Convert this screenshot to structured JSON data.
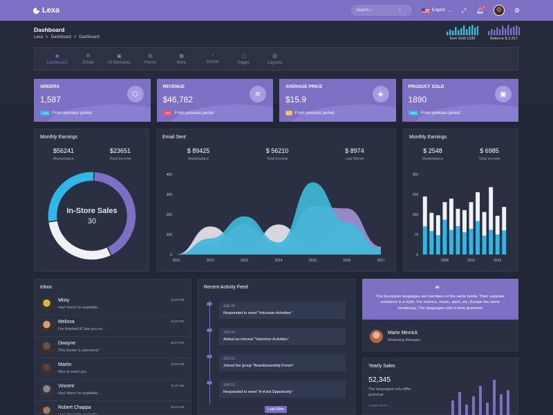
{
  "topbar": {
    "logo": "Lexa",
    "search_placeholder": "Search...",
    "language": "English",
    "notification_count": "3"
  },
  "header": {
    "title": "Dashboard",
    "breadcrumb": [
      "Lexa",
      ">",
      "Dashboard",
      ">",
      "Dashboard"
    ],
    "mini_stats": [
      {
        "label": "Item Sold 1230",
        "bars": [
          0.35,
          0.55,
          0.45,
          0.8,
          0.5,
          0.7,
          0.95,
          0.6,
          0.85,
          1.0,
          0.75,
          0.9
        ]
      },
      {
        "label": "Balance $ 2,317",
        "bars": [
          0.4,
          0.6,
          0.5,
          0.75,
          0.55,
          0.9,
          0.65,
          1.0,
          0.7,
          0.85,
          0.95,
          0.8
        ]
      }
    ]
  },
  "nav": [
    {
      "label": "Dashboard",
      "icon": "eye-icon",
      "glyph": "◉",
      "active": true
    },
    {
      "label": "Email",
      "icon": "mail-icon",
      "glyph": "✉",
      "active": false
    },
    {
      "label": "UI Elements",
      "icon": "briefcase-icon",
      "glyph": "▣",
      "active": false
    },
    {
      "label": "Forms",
      "icon": "form-icon",
      "glyph": "▤",
      "active": false
    },
    {
      "label": "More",
      "icon": "grid-icon",
      "glyph": "▦",
      "active": false
    },
    {
      "label": "Charts",
      "icon": "pie-icon",
      "glyph": "◔",
      "active": false
    },
    {
      "label": "Pages",
      "icon": "bag-icon",
      "glyph": "▢",
      "active": false
    },
    {
      "label": "Layouts",
      "icon": "layout-icon",
      "glyph": "▥",
      "active": false
    }
  ],
  "cards": [
    {
      "title": "ORDERS",
      "value": "1,587",
      "badge": "+11%",
      "badge_color": "#2fb7e8",
      "foot": "From previous period",
      "icon": "cube-icon",
      "glyph": "⬡"
    },
    {
      "title": "REVENUE",
      "value": "$46,782",
      "badge": "-29%",
      "badge_color": "#f0506e",
      "foot": "From previous period",
      "icon": "layers-icon",
      "glyph": "≋"
    },
    {
      "title": "AVERAGE PRICE",
      "value": "$15.9",
      "badge": "0%",
      "badge_color": "#f6b942",
      "foot": "From previous period",
      "icon": "tag-icon",
      "glyph": "◈"
    },
    {
      "title": "PRODUCT SOLD",
      "value": "1890",
      "badge": "+89%",
      "badge_color": "#2fb7e8",
      "foot": "From previous period",
      "icon": "bag-icon",
      "glyph": "▣"
    }
  ],
  "earnings_left": {
    "title": "Monthly Earnings",
    "stats": [
      {
        "value": "$56241",
        "label": "Marketplace"
      },
      {
        "value": "$23651",
        "label": "Total Income"
      }
    ],
    "donut_label": "In-Store Sales",
    "donut_value": "30"
  },
  "email_sent": {
    "title": "Email Sent",
    "stats": [
      {
        "value": "$ 89425",
        "label": "Marketplace"
      },
      {
        "value": "$ 56210",
        "label": "Total Income"
      },
      {
        "value": "$ 8974",
        "label": "Last Month"
      }
    ]
  },
  "earnings_right": {
    "title": "Monthly Earnings",
    "stats": [
      {
        "value": "$ 2548",
        "label": "Marketplace"
      },
      {
        "value": "$ 6985",
        "label": "Total Income"
      }
    ]
  },
  "inbox": {
    "title": "Inbox",
    "items": [
      {
        "name": "Misty",
        "msg": "Hey! there I'm available...",
        "time": "13:40 PM",
        "color": "#e0b53c"
      },
      {
        "name": "Melissa",
        "msg": "I've finished it! See you so...",
        "time": "13:34 PM",
        "color": "#d99a7a"
      },
      {
        "name": "Dwayne",
        "msg": "This theme is awesome!",
        "time": "13:17 PM",
        "color": "#6b5044"
      },
      {
        "name": "Martin",
        "msg": "Nice to meet you",
        "time": "12:20 PM",
        "color": "#5a4037"
      },
      {
        "name": "Vincent",
        "msg": "Hey! there I'm available...",
        "time": "11:47 AM",
        "color": "#7a8a98"
      },
      {
        "name": "Robert Chappa",
        "msg": "Hey! there I'm available...",
        "time": "10:12 AM",
        "color": "#9a7b68"
      }
    ]
  },
  "feed": {
    "title": "Recent Activity Feed",
    "items": [
      {
        "date": "JUN 25",
        "text": "Responded to need \"Volunteer Activities\""
      },
      {
        "date": "JUN 24",
        "text": "Added an interest \"Volunteer Activities\""
      },
      {
        "date": "JUN 23",
        "text": "Joined the group \"Boardsmanship Forum\""
      },
      {
        "date": "JUN 21",
        "text": "Responded to need \"In-Kind Opportunity\""
      }
    ],
    "load_more": "Load More"
  },
  "testimonial": {
    "quote": "The European languages are members of the same family. Their separate existence is a myth. For science, music, sport, etc, Europe the same vocabulary. The languages only in their grammar.",
    "name": "Marie Minnick",
    "role": "Marketing Manager"
  },
  "yearly": {
    "title": "Yearly Sales",
    "value": "52,345",
    "desc": "The languages only differ grammar",
    "link": "Learn more →",
    "bars": [
      0.35,
      0.55,
      0.25,
      0.45,
      0.7,
      0.3,
      0.85,
      0.5,
      0.6
    ]
  },
  "chart_data": [
    {
      "type": "pie",
      "title": "In-Store Sales",
      "labels": [
        "",
        "",
        ""
      ],
      "values": [
        42,
        30,
        28
      ],
      "colors": [
        "#7c6fc4",
        "#f0f1f4",
        "#2fb7e8"
      ]
    },
    {
      "type": "area",
      "x": [
        2011,
        2012,
        2013,
        2014,
        2015,
        2016,
        2017
      ],
      "ylim": [
        0,
        400
      ],
      "yticks": [
        0,
        100,
        200,
        300,
        400
      ],
      "series": [
        {
          "values": [
            0,
            140,
            20,
            150,
            30,
            130,
            20
          ],
          "color": "#e6e6ea"
        },
        {
          "values": [
            0,
            50,
            150,
            40,
            240,
            230,
            40
          ],
          "color": "#a08fd0"
        },
        {
          "values": [
            0,
            80,
            190,
            60,
            360,
            160,
            30
          ],
          "color": "#3fb8d8"
        }
      ]
    },
    {
      "type": "bar",
      "xticks": [
        "2008",
        "2012",
        "2016"
      ],
      "ylim": [
        0,
        300
      ],
      "yticks": [
        0,
        75,
        150,
        225,
        300
      ],
      "series": [
        {
          "values": [
            105,
            88,
            72,
            130,
            92,
            106,
            83,
            96,
            125,
            71,
            92,
            75,
            90
          ],
          "color": "#2fb7e8"
        },
        {
          "values": [
            112,
            68,
            75,
            66,
            117,
            65,
            83,
            100,
            108,
            88,
            160,
            70,
            88
          ],
          "color": "#f0f1f4"
        }
      ]
    }
  ]
}
